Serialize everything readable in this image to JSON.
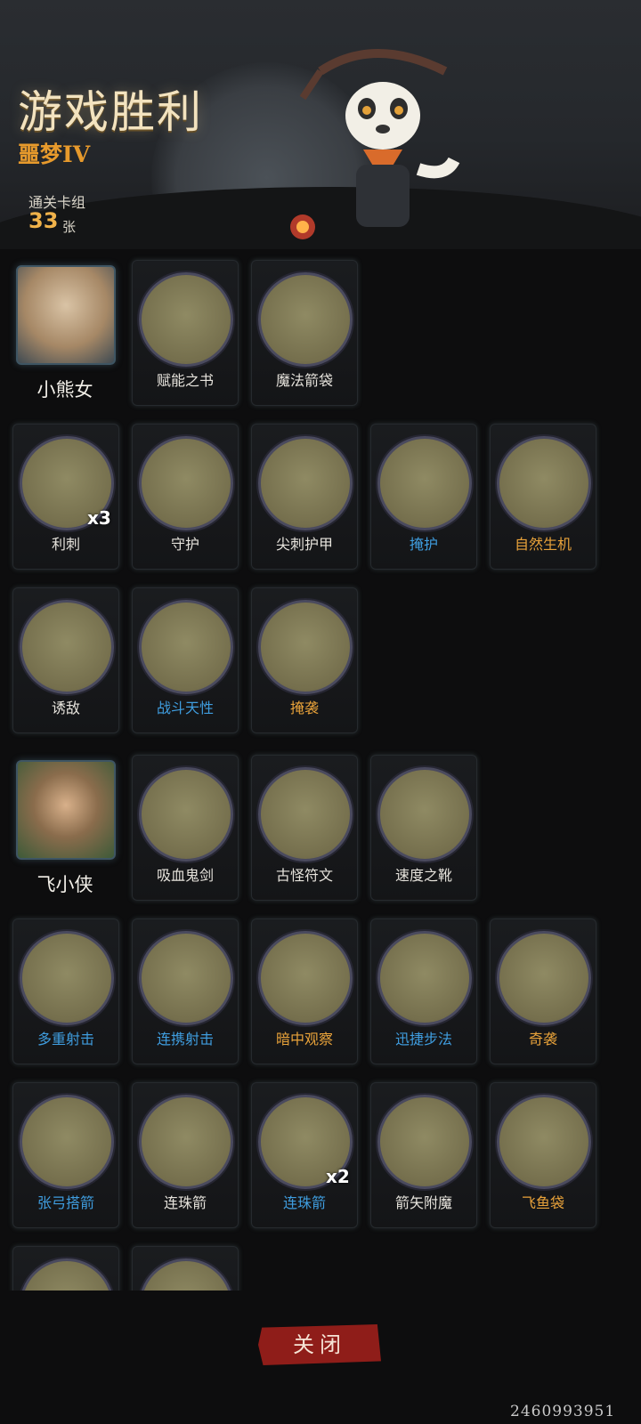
{
  "header": {
    "title": "游戏胜利",
    "subtitle": "噩梦IV",
    "deck_label": "通关卡组",
    "deck_count": "33",
    "deck_unit": "张"
  },
  "heroes": [
    {
      "name": "小熊女",
      "items": [
        "赋能之书",
        "魔法箭袋"
      ],
      "cards": [
        {
          "label": "利刺",
          "color": "white",
          "mult": "x3"
        },
        {
          "label": "守护",
          "color": "white"
        },
        {
          "label": "尖刺护甲",
          "color": "white"
        },
        {
          "label": "掩护",
          "color": "blue"
        },
        {
          "label": "自然生机",
          "color": "orange"
        },
        {
          "label": "诱敌",
          "color": "white"
        },
        {
          "label": "战斗天性",
          "color": "blue"
        },
        {
          "label": "掩袭",
          "color": "orange"
        }
      ]
    },
    {
      "name": "飞小侠",
      "items": [
        "吸血鬼剑",
        "古怪符文",
        "速度之靴"
      ],
      "cards": [
        {
          "label": "多重射击",
          "color": "blue"
        },
        {
          "label": "连携射击",
          "color": "blue"
        },
        {
          "label": "暗中观察",
          "color": "orange"
        },
        {
          "label": "迅捷步法",
          "color": "blue"
        },
        {
          "label": "奇袭",
          "color": "orange"
        },
        {
          "label": "张弓搭箭",
          "color": "blue"
        },
        {
          "label": "连珠箭",
          "color": "white"
        },
        {
          "label": "连珠箭",
          "color": "blue",
          "mult": "x2"
        },
        {
          "label": "箭矢附魔",
          "color": "white"
        },
        {
          "label": "飞鱼袋",
          "color": "orange"
        }
      ]
    }
  ],
  "close_label": "关闭",
  "uid": "2460993951"
}
